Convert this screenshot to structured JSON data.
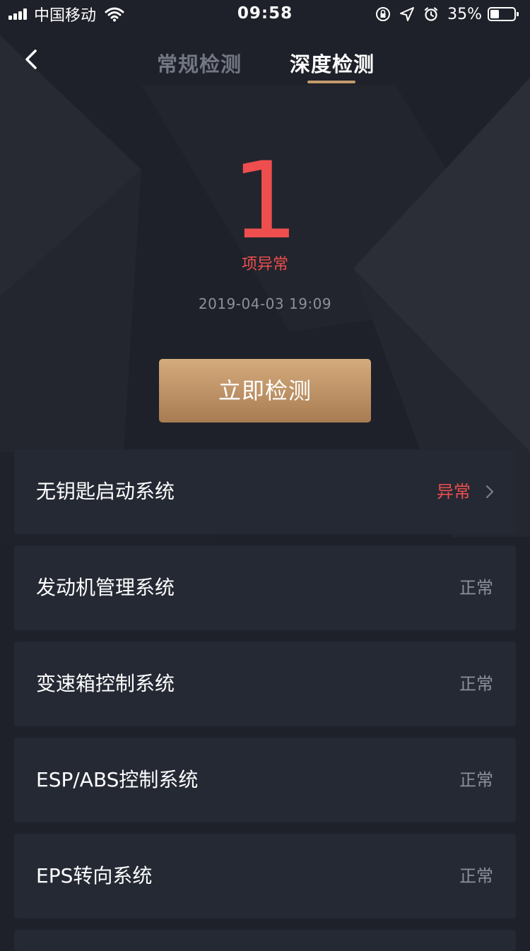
{
  "status_bar": {
    "carrier": "中国移动",
    "time": "09:58",
    "battery": "35%"
  },
  "nav": {
    "tabs": [
      {
        "label": "常规检测",
        "active": false
      },
      {
        "label": "深度检测",
        "active": true
      }
    ]
  },
  "summary": {
    "count": "1",
    "count_label": "项异常",
    "timestamp": "2019-04-03 19:09"
  },
  "action": {
    "check_now_label": "立即检测"
  },
  "systems": [
    {
      "name": "无钥匙启动系统",
      "status": "异常",
      "abnormal": true
    },
    {
      "name": "发动机管理系统",
      "status": "正常",
      "abnormal": false
    },
    {
      "name": "变速箱控制系统",
      "status": "正常",
      "abnormal": false
    },
    {
      "name": "ESP/ABS控制系统",
      "status": "正常",
      "abnormal": false
    },
    {
      "name": "EPS转向系统",
      "status": "正常",
      "abnormal": false
    }
  ],
  "colors": {
    "background": "#1e2129",
    "card": "#252934",
    "accent_gold": "#c39a6c",
    "abnormal_red": "#ee4e4e",
    "muted_text": "#8d909b"
  }
}
